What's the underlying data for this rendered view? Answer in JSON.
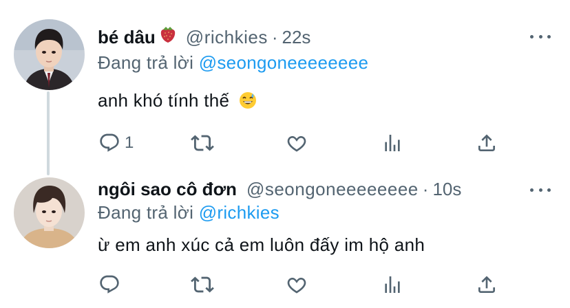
{
  "tweets": [
    {
      "name": "bé dâu",
      "name_emoji": "strawberry-emoji",
      "handle": "@richkies",
      "separator": "·",
      "time": "22s",
      "replying_prefix": "Đang trả lời",
      "replying_to": "@seongoneeeeeeee",
      "text": "anh khó tính thế",
      "text_emoji": "grinning-sweat-emoji",
      "reply_count": "1"
    },
    {
      "name": "ngôi sao cô đơn",
      "handle": "@seongoneeeeeeee",
      "separator": "·",
      "time": "10s",
      "replying_prefix": "Đang trả lời",
      "replying_to": "@richkies",
      "text": "ừ em anh xúc cả em luôn đấy im hộ anh",
      "reply_count": ""
    }
  ],
  "icons": [
    "more-icon",
    "reply-icon",
    "retweet-icon",
    "like-icon",
    "analytics-icon",
    "share-icon"
  ],
  "colors": {
    "text": "#0f1419",
    "secondary": "#536471",
    "link": "#1d9bf0",
    "thread_line": "#cfd9de"
  }
}
